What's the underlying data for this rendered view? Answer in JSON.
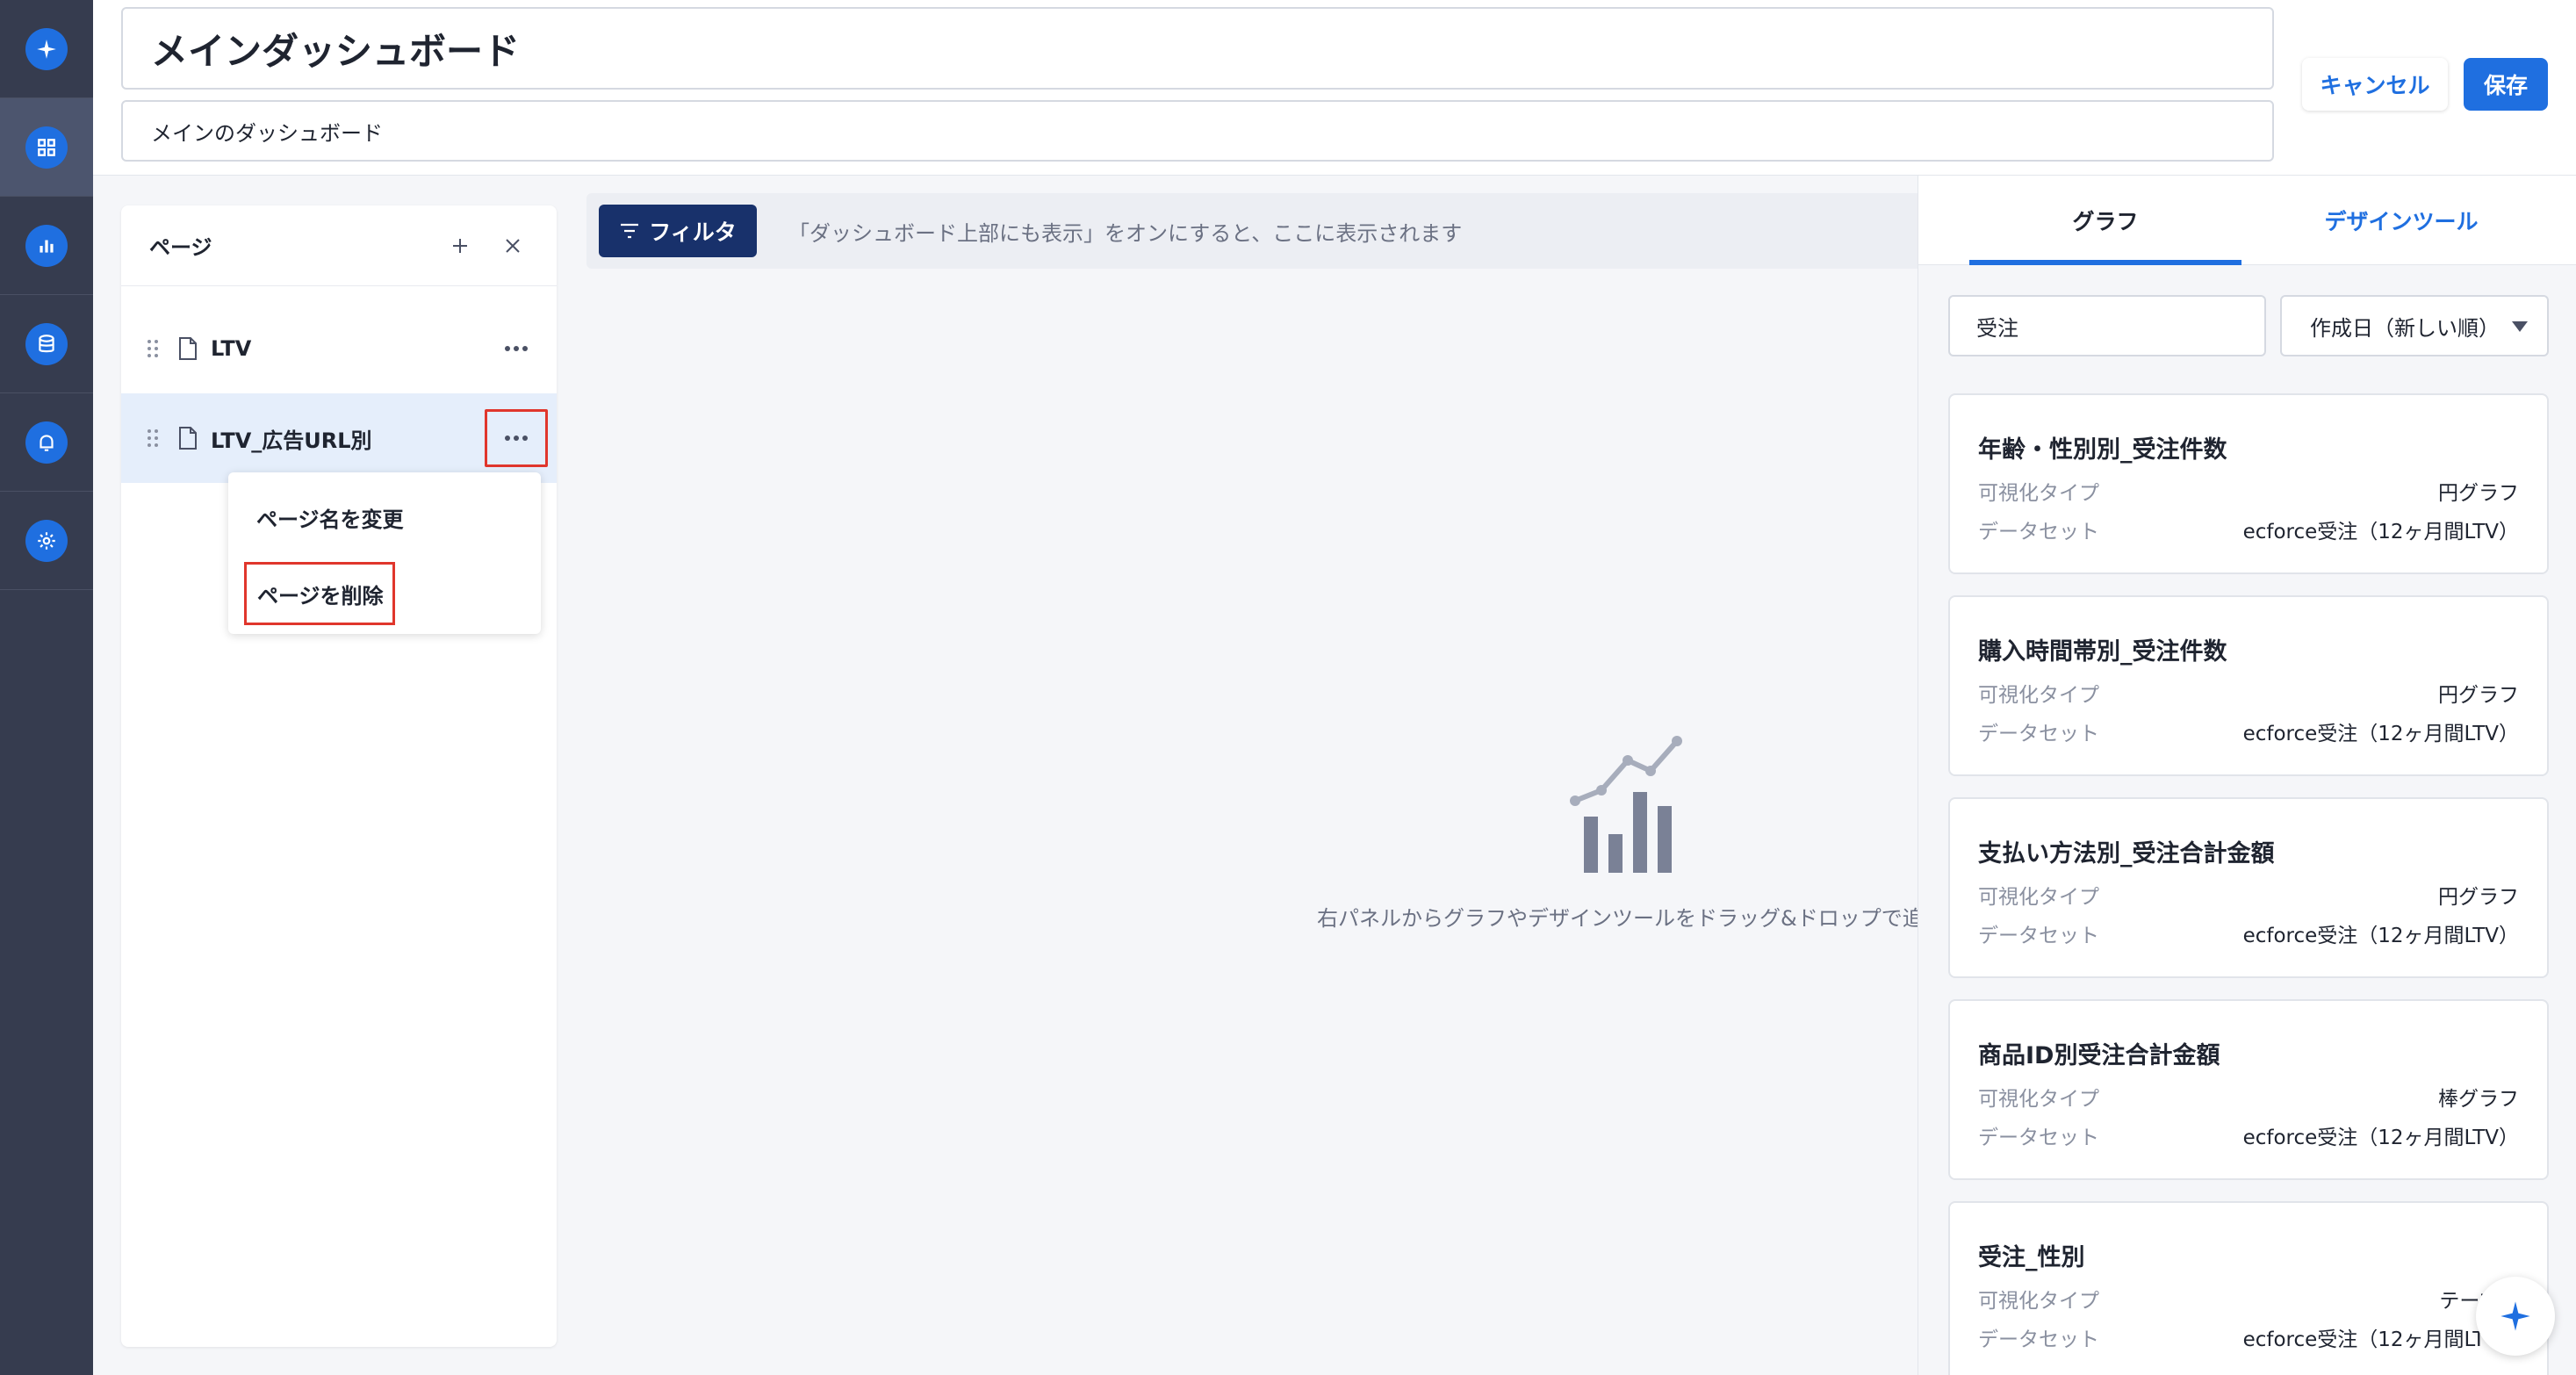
{
  "header": {
    "title": "メインダッシュボード",
    "description": "メインのダッシュボード",
    "cancel_label": "キャンセル",
    "save_label": "保存"
  },
  "sidebar": {
    "items": [
      {
        "icon": "sparkle-icon"
      },
      {
        "icon": "dashboard-icon",
        "active": true
      },
      {
        "icon": "bar-chart-icon"
      },
      {
        "icon": "database-icon"
      },
      {
        "icon": "bell-icon"
      },
      {
        "icon": "gear-icon"
      }
    ]
  },
  "pages": {
    "title": "ページ",
    "items": [
      {
        "label": "LTV"
      },
      {
        "label": "LTV_広告URL別",
        "selected": true
      }
    ],
    "menu": {
      "rename": "ページ名を変更",
      "delete": "ページを削除"
    }
  },
  "canvas": {
    "filter_label": "フィルタ",
    "filter_hint": "「ダッシュボード上部にも表示」をオンにすると、ここに表示されます",
    "empty_text": "右パネルからグラフやデザインツールをドラッグ&ドロップで追加"
  },
  "rpanel": {
    "tabs": [
      "グラフ",
      "デザインツール"
    ],
    "search_value": "受注",
    "sort_value": "作成日（新しい順）",
    "labels": {
      "type": "可視化タイプ",
      "dataset": "データセット"
    },
    "cards": [
      {
        "title": "年齢・性別別_受注件数",
        "type": "円グラフ",
        "dataset": "ecforce受注（12ヶ月間LTV）"
      },
      {
        "title": "購入時間帯別_受注件数",
        "type": "円グラフ",
        "dataset": "ecforce受注（12ヶ月間LTV）"
      },
      {
        "title": "支払い方法別_受注合計金額",
        "type": "円グラフ",
        "dataset": "ecforce受注（12ヶ月間LTV）"
      },
      {
        "title": "商品ID別受注合計金額",
        "type": "棒グラフ",
        "dataset": "ecforce受注（12ヶ月間LTV）"
      },
      {
        "title": "受注_性別",
        "type": "テーブル",
        "dataset": "ecforce受注（12ヶ月間LTV）"
      }
    ]
  },
  "colors": {
    "accent": "#1f6fe0",
    "rail": "#363c4f",
    "filter": "#18316b",
    "highlight": "#e0362c"
  }
}
